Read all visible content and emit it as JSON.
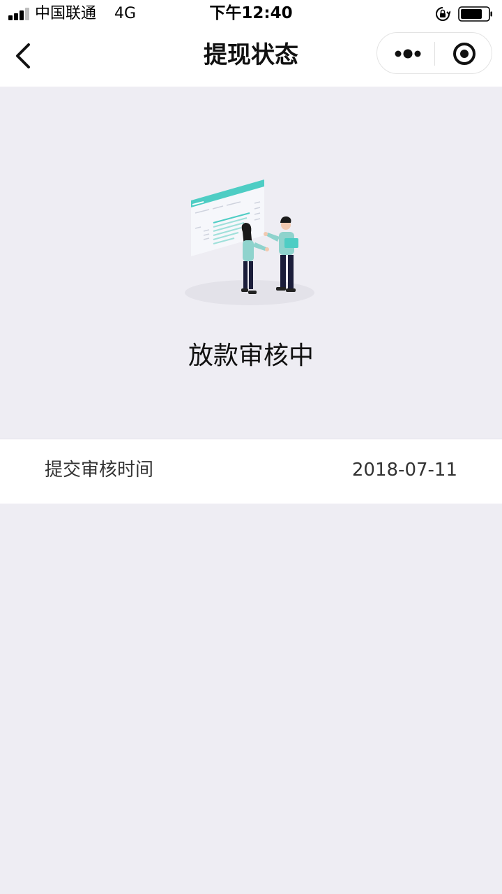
{
  "status_bar": {
    "carrier": "中国联通",
    "network": "4G",
    "time": "下午12:40",
    "icons": [
      "signal-icon",
      "rotation-lock-icon",
      "battery-icon"
    ]
  },
  "nav": {
    "title": "提现状态",
    "back_icon": "chevron-left-icon",
    "more_icon": "more-dots-icon",
    "close_icon": "target-close-icon"
  },
  "hero": {
    "illustration": "review-illustration",
    "status_text": "放款审核中"
  },
  "info": {
    "label": "提交审核时间",
    "value": "2018-07-11"
  },
  "colors": {
    "accent": "#4ecdc4",
    "background": "#eeedf3",
    "card": "#ffffff"
  }
}
